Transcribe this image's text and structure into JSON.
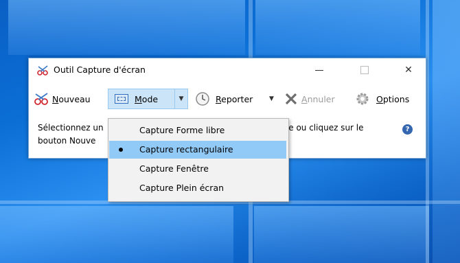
{
  "window": {
    "title": "Outil Capture d'écran",
    "close_glyph": "✕"
  },
  "toolbar": {
    "new_label_u": "N",
    "new_label_rest": "ouveau",
    "mode_label_u": "M",
    "mode_label_rest": "ode",
    "delay_label_u": "R",
    "delay_label_rest": "eporter",
    "cancel_label_u": "A",
    "cancel_label_rest": "nnuler",
    "options_label_u": "O",
    "options_label_rest": "ptions",
    "dropdown_glyph": "▼"
  },
  "status": {
    "line1_left": "Sélectionnez un",
    "line1_right": "de ou cliquez sur le",
    "line2_left": "bouton Nouve",
    "help_glyph": "?"
  },
  "mode_menu": {
    "items": [
      {
        "label": "Capture Forme libre"
      },
      {
        "label": "Capture rectangulaire"
      },
      {
        "label": "Capture Fenêtre"
      },
      {
        "label": "Capture Plein écran"
      }
    ],
    "selected_index": 1
  },
  "colors": {
    "accent_highlight": "#cce4f7",
    "menu_selected": "#91c9f7",
    "desktop_blue": "#0b6fd6",
    "help_blue": "#3467b0"
  }
}
